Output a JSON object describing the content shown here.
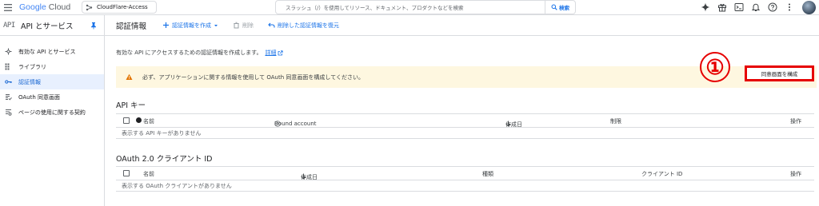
{
  "topbar": {
    "logo_google": "Google",
    "logo_cloud": "Cloud",
    "project": "CloudFlare-Access",
    "search_placeholder": "スラッシュ（/）を使用してリソース、ドキュメント、プロダクトなどを検索",
    "search_button": "検索",
    "icons": [
      "gemini-icon",
      "gift-icon",
      "cloud-shell-icon",
      "notifications-icon",
      "help-icon",
      "more-vert-icon"
    ]
  },
  "sidebar": {
    "logo": "API",
    "title": "API とサービス",
    "items": [
      {
        "label": "有効な API とサービス",
        "icon": "services-icon",
        "active": false
      },
      {
        "label": "ライブラリ",
        "icon": "library-icon",
        "active": false
      },
      {
        "label": "認証情報",
        "icon": "key-icon",
        "active": true
      },
      {
        "label": "OAuth 同意画面",
        "icon": "oauth-icon",
        "active": false
      },
      {
        "label": "ページの使用に関する契約",
        "icon": "agreements-icon",
        "active": false
      }
    ]
  },
  "main": {
    "title": "認証情報",
    "toolbar": {
      "create": "認証情報を作成",
      "delete": "削除",
      "restore": "削除した認証情報を復元"
    },
    "description": "有効な API にアクセスするための認証情報を作成します。",
    "details_link": "詳細",
    "banner": "必ず、アプリケーションに関する情報を使用して OAuth 同意画面を構成してください。",
    "annotation_number": "①",
    "configure_button": "同意画面を構成",
    "api_keys": {
      "title": "API キー",
      "headers": {
        "name": "名前",
        "bound": "Bound account",
        "created": "作成日",
        "restriction": "制限",
        "actions": "操作"
      },
      "empty": "表示する API キーがありません"
    },
    "oauth": {
      "title": "OAuth 2.0 クライアント ID",
      "headers": {
        "name": "名前",
        "created": "作成日",
        "type": "種類",
        "client_id": "クライアント ID",
        "actions": "操作"
      },
      "empty": "表示する OAuth クライアントがありません"
    }
  },
  "colors": {
    "accent": "#1a73e8",
    "annotation": "#e60000",
    "banner": "#fef7e0",
    "active_nav": "#e8f0fe"
  }
}
